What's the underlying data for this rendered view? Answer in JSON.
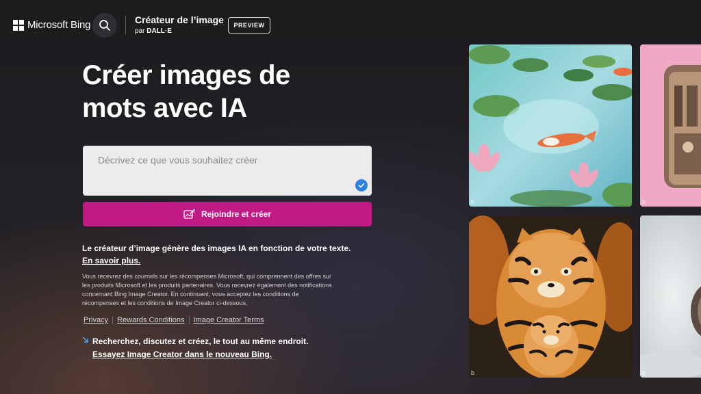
{
  "brand": {
    "name": "Microsoft Bing"
  },
  "header": {
    "title": "Créateur de l’image",
    "subtitle_prefix": "par",
    "subtitle_brand": "DALL·E",
    "preview_label": "PREVIEW"
  },
  "hero": {
    "title": "Créer images de mots avec IA",
    "prompt_placeholder": "Décrivez ce que vous souhaitez créer",
    "join_label": "Rejoindre et créer"
  },
  "info": {
    "description": "Le créateur d’image génère des images IA en fonction de votre texte.",
    "learn_more": "En savoir plus.",
    "fine_print": "Vous recevrez des courriels sur les récompenses Microsoft, qui comprennent des offres sur les produits Microsoft et les produits partenaires. Vous recevrez également des notifications concernant Bing Image Creator. En continuant, vous acceptez les conditions de récompenses et les conditions de Image Creator ci-dessous."
  },
  "links": {
    "privacy": "Privacy",
    "rewards": "Rewards Conditions",
    "terms": "Image Creator Terms"
  },
  "promo": {
    "text": "Recherchez, discutez et créez, le tout au même endroit.",
    "link": "Essayez Image Creator dans le nouveau Bing."
  },
  "gallery": {
    "badge": "b",
    "tiles": [
      "koi-pond-painting",
      "retro-device",
      "tiger-nesting-dolls",
      "ring-closeup"
    ]
  },
  "colors": {
    "accent": "#c11a84",
    "check": "#2f80e0",
    "prompt_bg": "#ececec"
  },
  "icons": [
    "search-icon",
    "create-icon",
    "check-icon",
    "arrow-icon"
  ]
}
